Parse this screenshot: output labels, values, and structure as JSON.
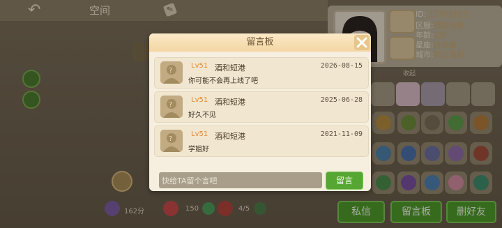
{
  "header": {
    "title": "空间",
    "back_icon": "back-arrow-icon",
    "edit_icon": "pencil-icon"
  },
  "profile": {
    "id_label": "ID:",
    "id_value": "17363615",
    "zone_label": "区服:",
    "zone_value": "霓虹仙境",
    "age_label": "年龄:",
    "age_value": "1岁",
    "sign_label": "星座:",
    "sign_value": "白羊座",
    "city_label": "城市:",
    "city_value": "浙江温州",
    "collapse_label": "收起"
  },
  "stats": {
    "points": "162分",
    "likes": "150",
    "flowers": "4/5"
  },
  "bottom_buttons": {
    "private_message": "私信",
    "message_board": "留言板",
    "delete_friend": "删好友"
  },
  "modal": {
    "title": "留言板",
    "messages": [
      {
        "level": "Lv51",
        "name": "酒和短港",
        "date": "2026-08-15",
        "text": "你可能不会再上线了吧"
      },
      {
        "level": "Lv51",
        "name": "酒和短港",
        "date": "2025-06-28",
        "text": "好久不见"
      },
      {
        "level": "Lv51",
        "name": "酒和短港",
        "date": "2021-11-09",
        "text": "学姐好"
      }
    ],
    "input_placeholder": "快给TA留个言吧",
    "submit_label": "留言"
  },
  "colors": {
    "accent_green": "#56a634",
    "level_orange": "#e28a33",
    "modal_bg": "#f6efe0"
  }
}
